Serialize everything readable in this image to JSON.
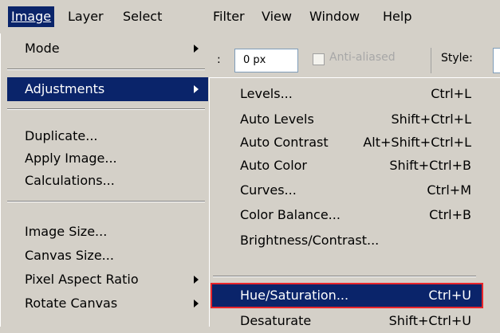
{
  "menubar": {
    "items": [
      {
        "label": "Image",
        "active": true
      },
      {
        "label": "Layer"
      },
      {
        "label": "Select"
      },
      {
        "label": "Filter"
      },
      {
        "label": "View"
      },
      {
        "label": "Window"
      },
      {
        "label": "Help"
      }
    ]
  },
  "options_bar": {
    "feather_value": "0 px",
    "anti_aliased_label": "Anti-aliased",
    "style_label": "Style:"
  },
  "image_menu": {
    "items": [
      {
        "label": "Mode",
        "submenu": true
      },
      {
        "label": "Adjustments",
        "submenu": true,
        "highlighted": true
      },
      {
        "label": "Duplicate..."
      },
      {
        "label": "Apply Image..."
      },
      {
        "label": "Calculations..."
      },
      {
        "label": "Image Size..."
      },
      {
        "label": "Canvas Size..."
      },
      {
        "label": "Pixel Aspect Ratio",
        "submenu": true
      },
      {
        "label": "Rotate Canvas",
        "submenu": true
      }
    ]
  },
  "adjustments_menu": {
    "items": [
      {
        "label": "Levels...",
        "shortcut": "Ctrl+L"
      },
      {
        "label": "Auto Levels",
        "shortcut": "Shift+Ctrl+L"
      },
      {
        "label": "Auto Contrast",
        "shortcut": "Alt+Shift+Ctrl+L"
      },
      {
        "label": "Auto Color",
        "shortcut": "Shift+Ctrl+B"
      },
      {
        "label": "Curves...",
        "shortcut": "Ctrl+M"
      },
      {
        "label": "Color Balance...",
        "shortcut": "Ctrl+B"
      },
      {
        "label": "Brightness/Contrast...",
        "shortcut": ""
      },
      {
        "label": "Hue/Saturation...",
        "shortcut": "Ctrl+U",
        "highlighted": true
      },
      {
        "label": "Desaturate",
        "shortcut": "Shift+Ctrl+U"
      }
    ]
  },
  "colors": {
    "menu_bg": "#d4d0c8",
    "highlight": "#0a246a",
    "highlight_border": "#e8262b"
  }
}
